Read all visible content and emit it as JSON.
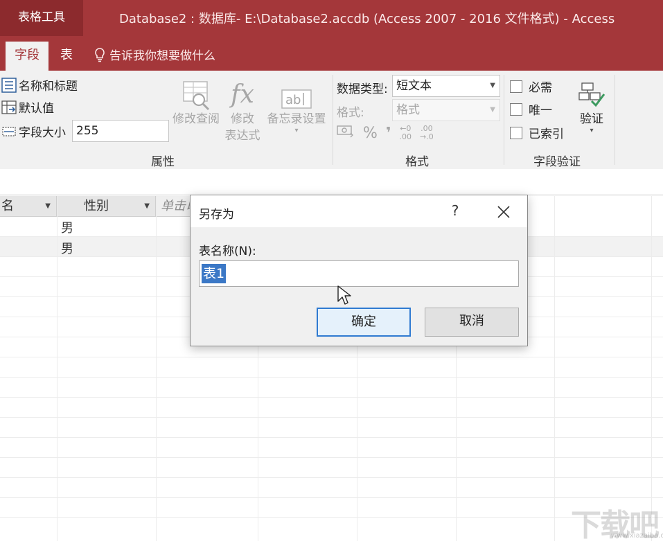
{
  "titlebar": {
    "tools_tab": "表格工具",
    "window_title": "Database2 : 数据库- E:\\Database2.accdb (Access 2007 - 2016 文件格式)  -  Access"
  },
  "tabs": {
    "field": "字段",
    "table": "表",
    "tell_me": "告诉我你想要做什么"
  },
  "ribbon": {
    "properties": {
      "name_caption": "名称和标题",
      "default_value": "默认值",
      "field_size_label": "字段大小",
      "field_size_value": "255",
      "modify_lookups": "修改查阅",
      "modify_expression_line1": "修改",
      "modify_expression_line2": "表达式",
      "memo_settings": "备忘录设置",
      "group_label": "属性"
    },
    "formatting": {
      "data_type_label": "数据类型:",
      "data_type_value": "短文本",
      "format_label": "格式:",
      "format_value": "格式",
      "percent": "%",
      "comma": "❜",
      "dec_increase_top": "←0",
      "dec_increase_bottom": ".00",
      "dec_decrease_top": ".00",
      "dec_decrease_bottom": "→.0",
      "group_label": "格式"
    },
    "validation": {
      "required": "必需",
      "unique": "唯一",
      "indexed": "已索引",
      "validation": "验证",
      "group_label": "字段验证"
    }
  },
  "datasheet": {
    "columns": [
      "名",
      "性别",
      "单击以添加"
    ],
    "rows": [
      [
        "",
        "男"
      ],
      [
        "",
        "男"
      ]
    ]
  },
  "dialog": {
    "title": "另存为",
    "help": "?",
    "label": "表名称(N):",
    "input_value": "表1",
    "ok": "确定",
    "cancel": "取消"
  },
  "watermark": {
    "text": "下载吧",
    "url": "www.xiazaiba.com"
  },
  "colors": {
    "access_red": "#a4373a",
    "selection_blue": "#3b78c6",
    "ok_border": "#2f7ad1"
  }
}
